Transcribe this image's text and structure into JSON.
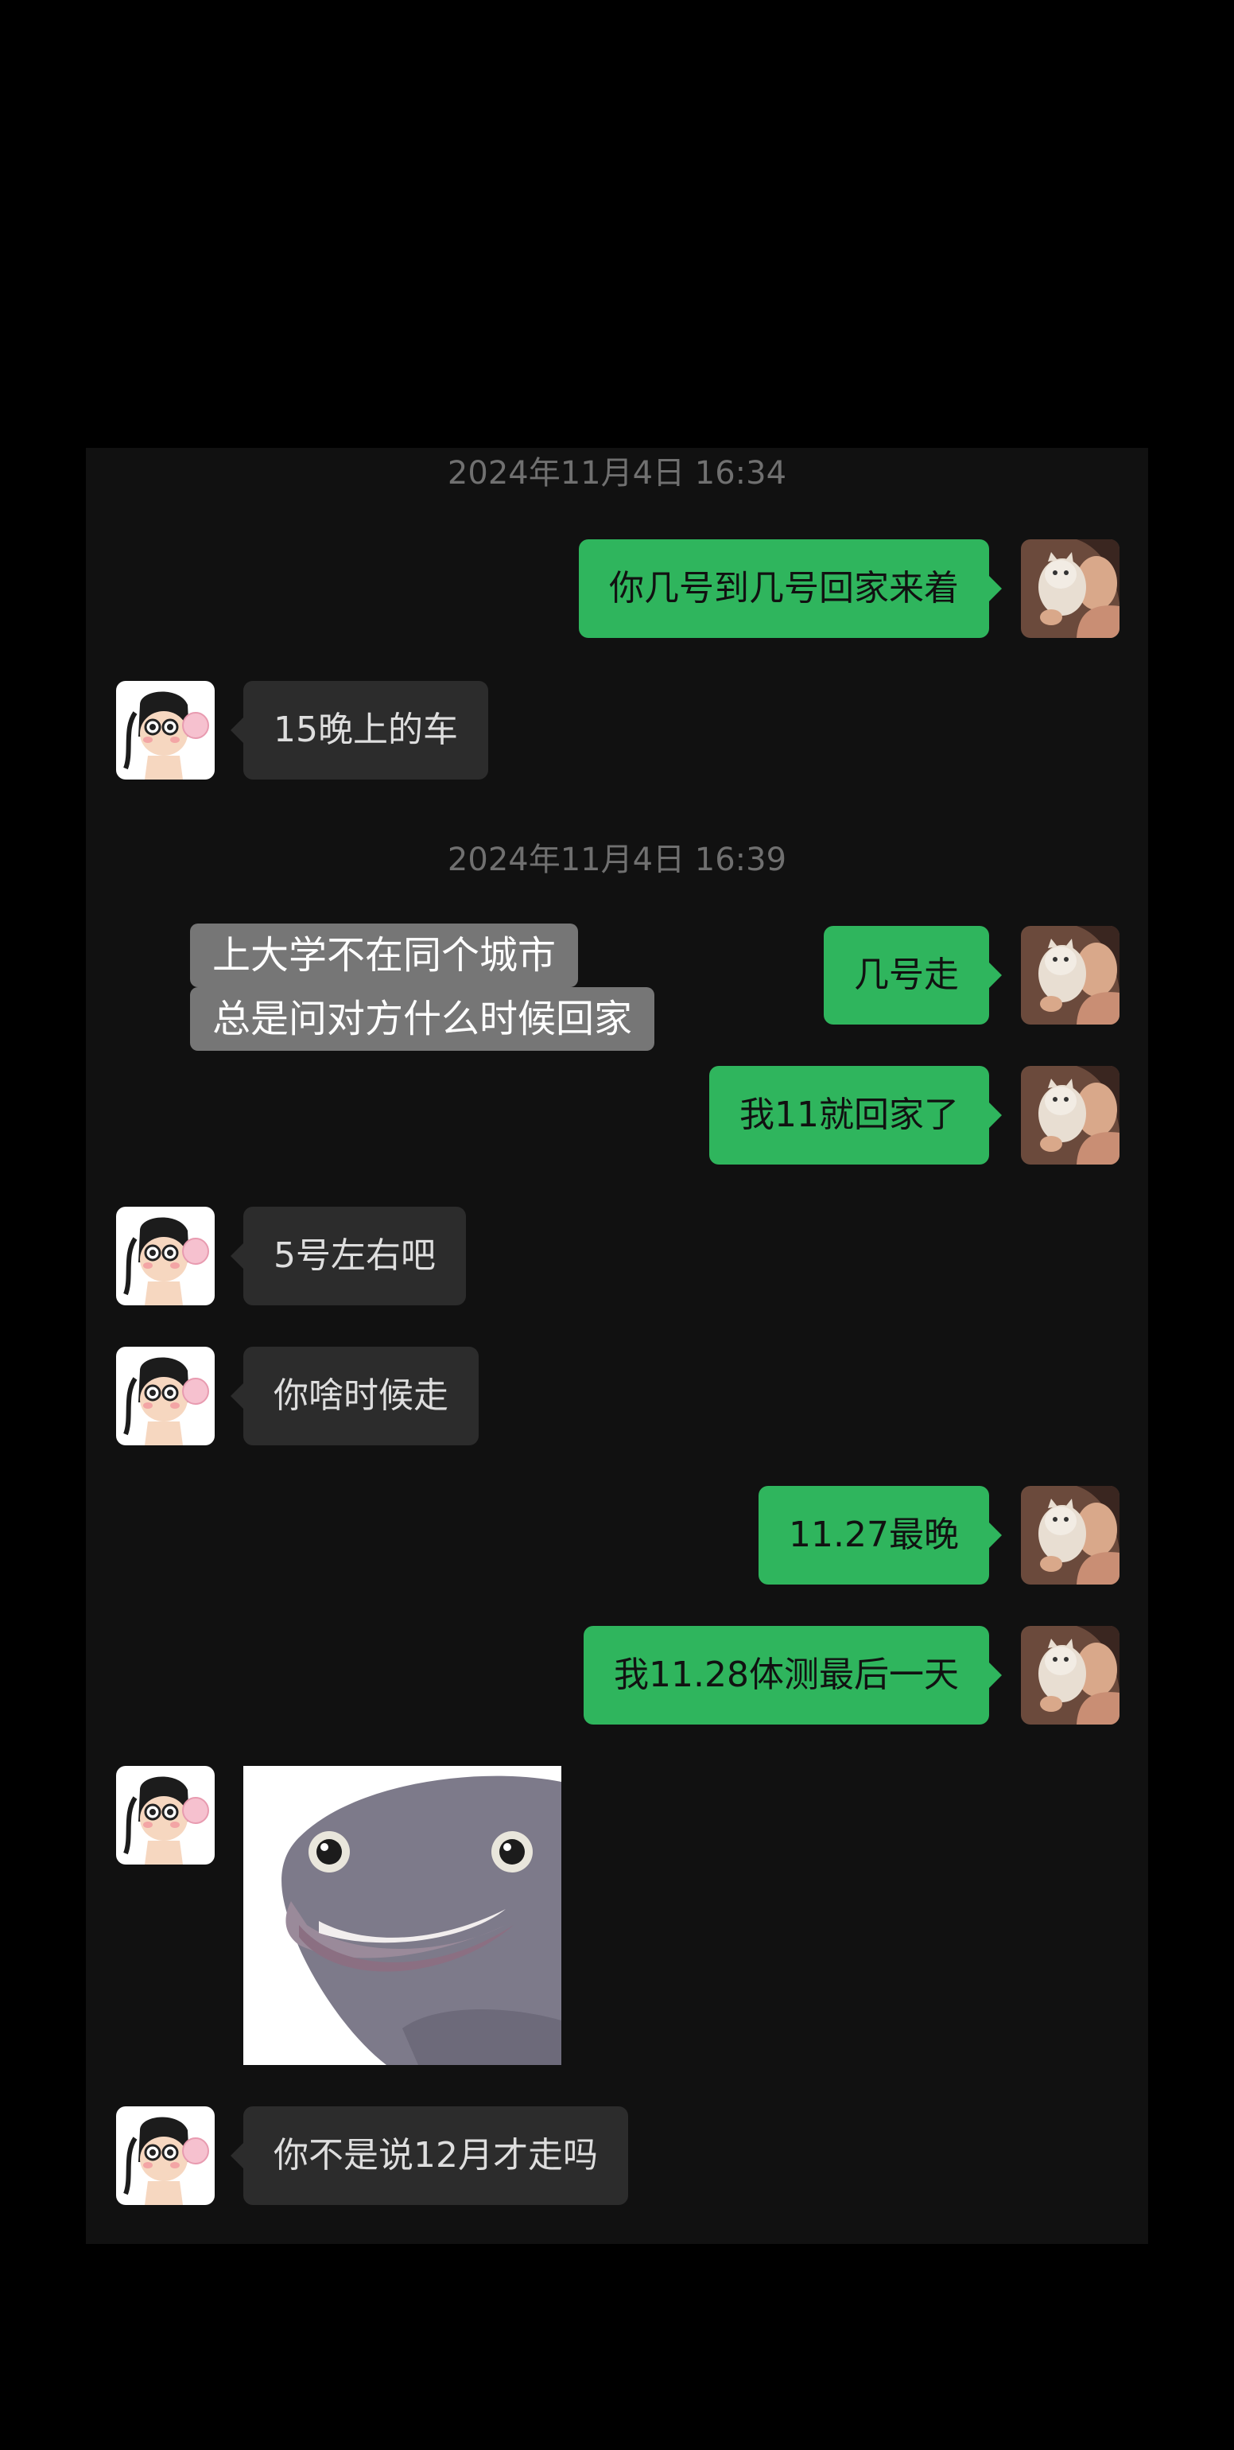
{
  "timestamps": [
    "2024年11月4日 16:34",
    "2024年11月4日 16:39"
  ],
  "messages": [
    {
      "sender": "me",
      "text": "你几号到几号回家来着"
    },
    {
      "sender": "them",
      "text": "15晚上的车"
    },
    {
      "sender": "me",
      "text": "几号走"
    },
    {
      "sender": "me",
      "text": "我11就回家了"
    },
    {
      "sender": "them",
      "text": "5号左右吧"
    },
    {
      "sender": "them",
      "text": "你啥时候走"
    },
    {
      "sender": "me",
      "text": "11.27最晚"
    },
    {
      "sender": "me",
      "text": "我11.28体测最后一天"
    },
    {
      "sender": "them",
      "type": "sticker",
      "sticker": "smiling-fish-sticker"
    },
    {
      "sender": "them",
      "text": "你不是说12月才走吗"
    }
  ],
  "overlay_caption": {
    "line1": "上大学不在同个城市",
    "line2": "总是问对方什么时候回家"
  },
  "avatars": {
    "me": "girl-holding-cat-avatar",
    "them": "cartoon-girl-bubblegum-avatar"
  },
  "colors": {
    "page_background": "#000000",
    "chat_background": "#111111",
    "my_bubble": "#2fb55d",
    "their_bubble": "#2c2c2c",
    "timestamp_text": "#707070",
    "caption_background": "#767676"
  }
}
